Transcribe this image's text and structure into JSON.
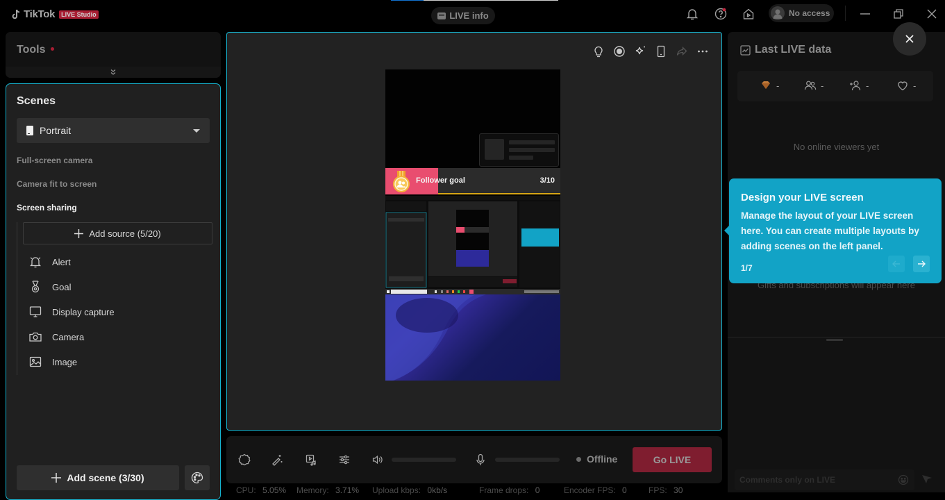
{
  "app": {
    "brand": "TikTok",
    "badge": "LIVE Studio",
    "live_info_label": "LIVE info",
    "account_label": "No access",
    "colors": {
      "accent": "#16b4d0",
      "brand_red": "#a81e33",
      "tooltip": "#12a3c6"
    }
  },
  "tools": {
    "title": "Tools"
  },
  "scenes": {
    "title": "Scenes",
    "orientation": "Portrait",
    "items": [
      {
        "label": "Full-screen camera",
        "active": false
      },
      {
        "label": "Camera fit to screen",
        "active": false
      },
      {
        "label": "Screen sharing",
        "active": true
      }
    ],
    "add_source_label": "Add source (5/20)",
    "sources": [
      {
        "label": "Alert",
        "icon": "bell-icon"
      },
      {
        "label": "Goal",
        "icon": "medal-icon"
      },
      {
        "label": "Display capture",
        "icon": "monitor-icon"
      },
      {
        "label": "Camera",
        "icon": "camera-icon"
      },
      {
        "label": "Image",
        "icon": "image-icon"
      }
    ],
    "add_scene_label": "Add scene (3/30)"
  },
  "preview": {
    "goal_label": "Follower goal",
    "goal_count": "3/10",
    "goal_progress": 0.3
  },
  "controls": {
    "status": "Offline",
    "go_live_label": "Go LIVE",
    "speaker_level": 0,
    "mic_level": 0
  },
  "stats": [
    {
      "label": "CPU:",
      "value": "5.05%"
    },
    {
      "label": "Memory:",
      "value": "3.71%"
    },
    {
      "label": "Upload kbps:",
      "value": "0kb/s"
    },
    {
      "label": "Frame drops:",
      "value": "0"
    },
    {
      "label": "Encoder FPS:",
      "value": "0"
    },
    {
      "label": "FPS:",
      "value": "30"
    }
  ],
  "right_panel": {
    "title": "Last LIVE data",
    "metrics": [
      {
        "icon": "diamond-icon",
        "value": "-"
      },
      {
        "icon": "viewers-icon",
        "value": "-"
      },
      {
        "icon": "new-follower-icon",
        "value": "-"
      },
      {
        "icon": "heart-icon",
        "value": "-"
      }
    ],
    "no_viewers_text": "No online viewers yet",
    "gifts_text": "Gifts and subscriptions will appear here",
    "comment_placeholder": "Comments only on LIVE"
  },
  "tooltip": {
    "title": "Design your LIVE screen",
    "body": "Manage the layout of your LIVE screen here. You can create multiple layouts by adding scenes on the left panel.",
    "step": "1/7"
  }
}
